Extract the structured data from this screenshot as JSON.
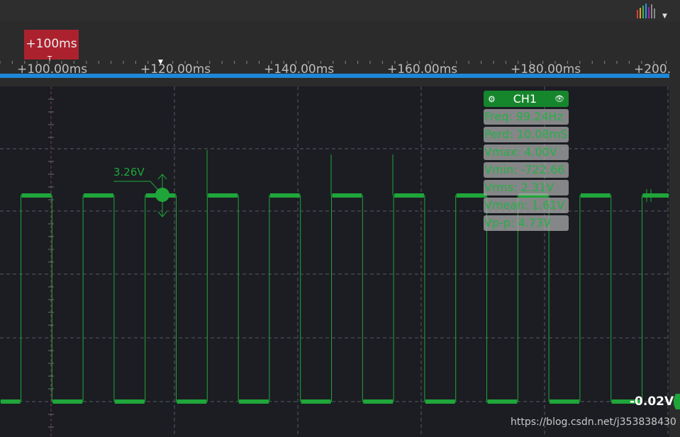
{
  "timeline": {
    "tick_labels": [
      "+100.00ms",
      "+120.00ms",
      "+140.00ms",
      "+160.00ms",
      "+180.00ms",
      "+200."
    ],
    "cursor_label": "+100ms"
  },
  "waveform": {
    "cursor_voltage_label": "3.26V",
    "zero_level_label": "-0.02V",
    "color": "#1fa63a",
    "frequency_hz": 99.24
  },
  "channel_panel": {
    "title": "CH1",
    "stats": [
      "Freq: 99.24Hz",
      "Perd: 10.08mS",
      "Vmax: 4.00V",
      "Vmin: -722.66",
      "Vrms: 2.31V",
      "Vmean: 1.61V",
      "Vp-p: 4.73V"
    ]
  },
  "watermark": "https://blog.csdn.net/j353838430",
  "colors": {
    "background": "#1b1d22",
    "accent_blue": "#1e88d8",
    "cursor_red": "#b7212f",
    "channel_green": "#16862d"
  }
}
